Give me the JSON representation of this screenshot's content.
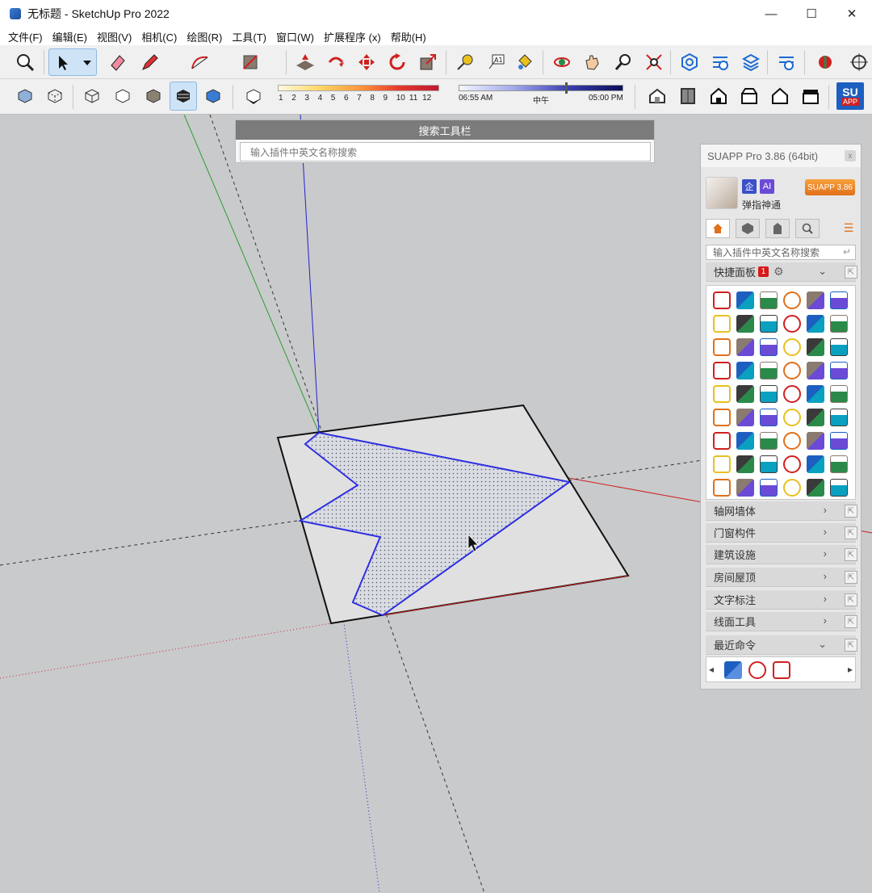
{
  "window": {
    "title": "无标题 - SketchUp Pro 2022",
    "minimize_glyph": "—",
    "maximize_glyph": "☐",
    "close_glyph": "✕"
  },
  "menu": {
    "items": [
      "文件(F)",
      "编辑(E)",
      "视图(V)",
      "相机(C)",
      "绘图(R)",
      "工具(T)",
      "窗口(W)",
      "扩展程序 (x)",
      "帮助(H)"
    ]
  },
  "toolbar": {
    "shadow_ticks": [
      "1",
      "2",
      "3",
      "4",
      "5",
      "6",
      "7",
      "8",
      "9",
      "10",
      "11",
      "12"
    ],
    "time_start": "06:55 AM",
    "time_mid": "中午",
    "time_end": "05:00 PM",
    "su_app_label_top": "SU",
    "su_app_label_bottom": "APP"
  },
  "search_toolbar": {
    "title": "搜索工具栏",
    "placeholder": "输入插件中英文名称搜索"
  },
  "suapp": {
    "title": "SUAPP Pro 3.86 (64bit)",
    "close_glyph": "x",
    "badge_qi": "企",
    "badge_ai": "AI",
    "username": "弹指神通",
    "version_pill": "SUAPP 3.86",
    "search_placeholder": "输入插件中英文名称搜索",
    "enter_glyph": "↵",
    "list_glyph": "☰",
    "quick_panel_label": "快捷面板",
    "quick_panel_badge": "1",
    "quick_panel_gear": "⚙",
    "chevron_right": "›",
    "chevron_down": "⌄",
    "ext_glyph": "⇱",
    "categories": [
      "轴网墙体",
      "门窗构件",
      "建筑设施",
      "房间屋顶",
      "文字标注",
      "线面工具"
    ],
    "recent_label": "最近命令",
    "recent_prev": "◂",
    "recent_next": "▸"
  },
  "colors": {
    "selection_blue": "#1a1adf",
    "axis_red": "#cc2222",
    "axis_green": "#2e9e2e",
    "axis_blue": "#2222cc",
    "suapp_orange": "#e0701a"
  }
}
